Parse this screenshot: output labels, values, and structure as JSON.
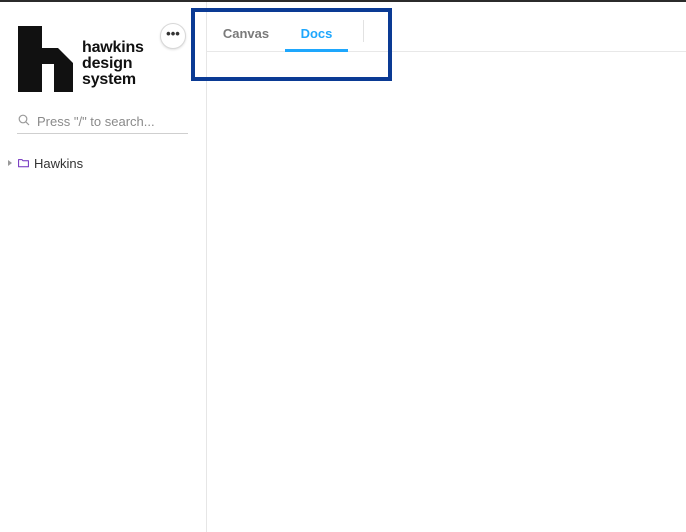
{
  "sidebar": {
    "logo": {
      "line1": "hawkins",
      "line2": "design",
      "line3": "system"
    },
    "more_button_label": "•••",
    "search": {
      "placeholder": "Press \"/\" to search...",
      "value": ""
    },
    "tree": [
      {
        "label": "Hawkins",
        "icon": "folder-icon",
        "expanded": false
      }
    ]
  },
  "toolbar": {
    "tabs": [
      {
        "label": "Canvas",
        "active": false
      },
      {
        "label": "Docs",
        "active": true
      }
    ]
  },
  "colors": {
    "accent": "#1ea7fd",
    "folder": "#6f2dbd",
    "highlight_box": "#0a3a94",
    "logo": "#111111"
  }
}
